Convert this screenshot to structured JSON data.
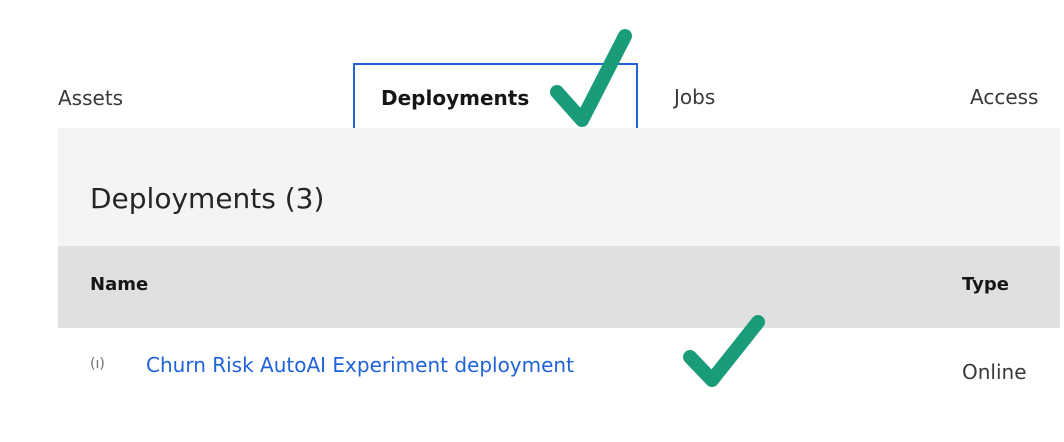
{
  "tabs": {
    "assets": "Assets",
    "deployments": "Deployments",
    "jobs": "Jobs",
    "access": "Access"
  },
  "section": {
    "title": "Deployments (3)"
  },
  "table": {
    "columns": [
      "Name",
      "Type"
    ],
    "rows": [
      {
        "icon": "online-deployment-icon",
        "name": "Churn Risk AutoAI Experiment deployment",
        "type": "Online"
      }
    ]
  },
  "colors": {
    "accent": "#1f62d9",
    "check": "#1a9c7a",
    "panel_bg": "#f4f4f4",
    "header_bg": "#e0e0e0"
  }
}
